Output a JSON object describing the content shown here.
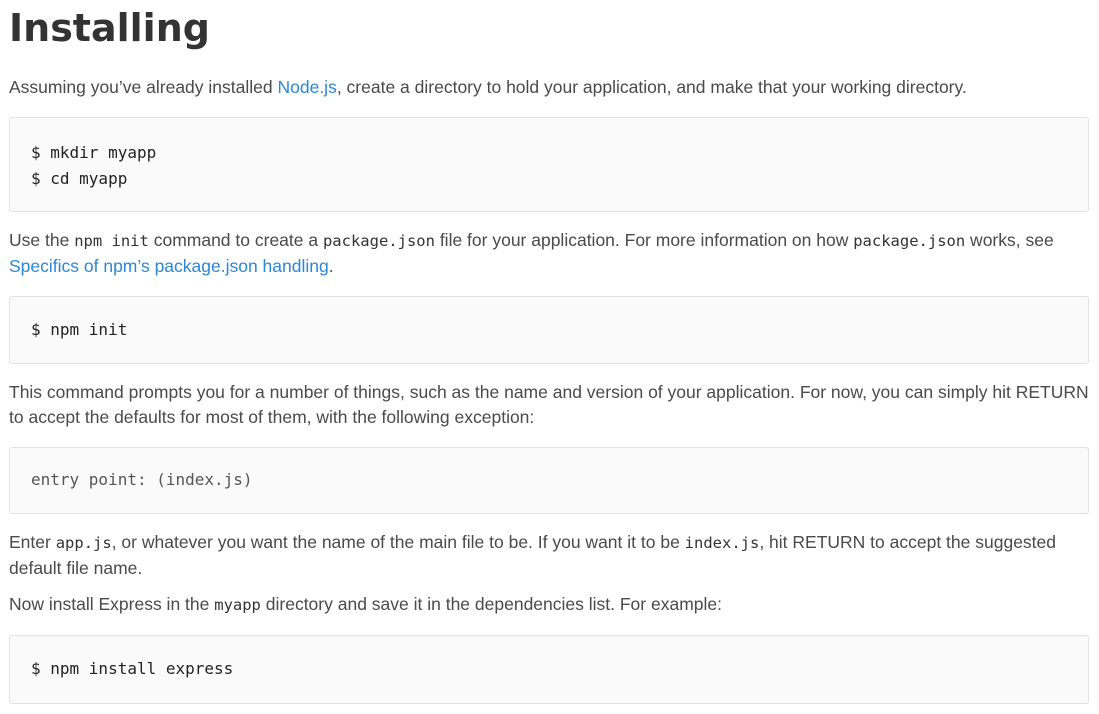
{
  "heading": "Installing",
  "para1": {
    "before": "Assuming you’ve already installed ",
    "link": "Node.js",
    "after": ", create a directory to hold your application, and make that your working directory."
  },
  "code1": [
    "$ mkdir myapp",
    "$ cd myapp"
  ],
  "para2": {
    "t1": "Use the ",
    "c1": "npm init",
    "t2": " command to create a ",
    "c2": "package.json",
    "t3": " file for your application. For more information on how ",
    "c3": "package.json",
    "t4": " works, see ",
    "link": "Specifics of npm’s package.json handling",
    "t5": "."
  },
  "code2": [
    "$ npm init"
  ],
  "para3": "This command prompts you for a number of things, such as the name and version of your application. For now, you can simply hit RETURN to accept the defaults for most of them, with the following exception:",
  "code3": [
    "entry point: (index.js)"
  ],
  "para4": {
    "t1": "Enter ",
    "c1": "app.js",
    "t2": ", or whatever you want the name of the main file to be. If you want it to be ",
    "c2": "index.js",
    "t3": ", hit RETURN to accept the suggested default file name."
  },
  "para5": {
    "t1": "Now install Express in the ",
    "c1": "myapp",
    "t2": " directory and save it in the dependencies list. For example:"
  },
  "code4": [
    "$ npm install express"
  ]
}
